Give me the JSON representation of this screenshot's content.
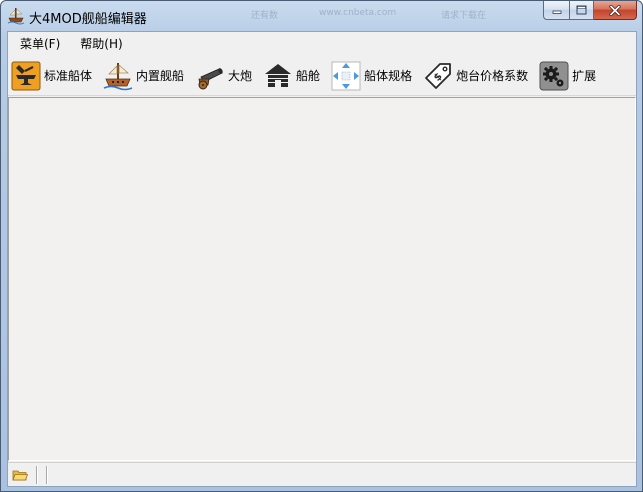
{
  "window": {
    "title": "大4MOD舰船编辑器",
    "background_hint_1": "还有数",
    "background_hint_2": "www.cnbeta.com",
    "background_hint_3": "请求下载在"
  },
  "menu": [
    {
      "label": "菜单(F)"
    },
    {
      "label": "帮助(H)"
    }
  ],
  "toolbar": [
    {
      "label": "标准船体",
      "icon": "anvil-icon"
    },
    {
      "label": "内置舰船",
      "icon": "ship-icon"
    },
    {
      "label": "大炮",
      "icon": "cannon-icon"
    },
    {
      "label": "船舱",
      "icon": "cabin-icon"
    },
    {
      "label": "船体规格",
      "icon": "resize-arrows-icon"
    },
    {
      "label": "炮台价格系数",
      "icon": "price-tag-icon"
    },
    {
      "label": "扩展",
      "icon": "gear-icon"
    }
  ],
  "colors": {
    "client_bg": "#f0f0f0",
    "content_bg": "#f2f1f0",
    "titlebar_accent": "#b5cce6",
    "close_button": "#c2452c"
  }
}
